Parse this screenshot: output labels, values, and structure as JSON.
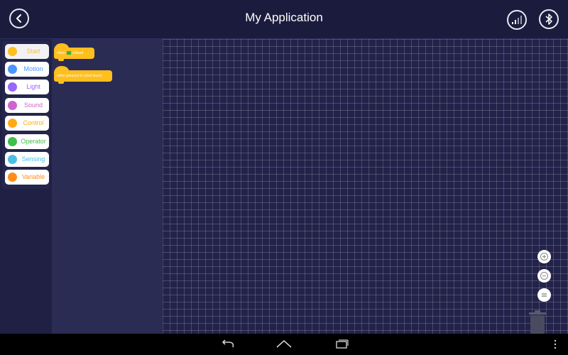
{
  "header": {
    "title": "My Application",
    "icons": {
      "back": "back-arrow-icon",
      "signal": "signal-bars-icon",
      "bluetooth": "bluetooth-icon"
    }
  },
  "categories": [
    {
      "label": "Start",
      "color": "#ffbf1f",
      "active": true
    },
    {
      "label": "Motion",
      "color": "#4c97ff"
    },
    {
      "label": "Light",
      "color": "#9966ff"
    },
    {
      "label": "Sound",
      "color": "#cf63cf"
    },
    {
      "label": "Control",
      "color": "#ffab19"
    },
    {
      "label": "Operator",
      "color": "#40bf4a"
    },
    {
      "label": "Sensing",
      "color": "#4cbfe6"
    },
    {
      "label": "Variable",
      "color": "#ff8c1a"
    }
  ],
  "blocks": [
    {
      "pre": "when",
      "post": "clicked",
      "icon": "green-flag-icon"
    },
    {
      "text": "when pressed in robot board"
    }
  ],
  "workspace": {
    "zoom_controls": {
      "in": "zoom-in-icon",
      "out": "zoom-out-icon",
      "reset": "zoom-reset-icon"
    },
    "trash": "trash-can-icon"
  },
  "android_nav": {
    "back": "nav-back-icon",
    "home": "nav-home-icon",
    "recent": "nav-recent-apps-icon",
    "menu": "nav-overflow-menu-icon"
  },
  "colors": {
    "topbar": "#1b1c3d",
    "workspace": "#22224a",
    "block": "#ffbf1f",
    "flyout": "#2b2c54"
  }
}
